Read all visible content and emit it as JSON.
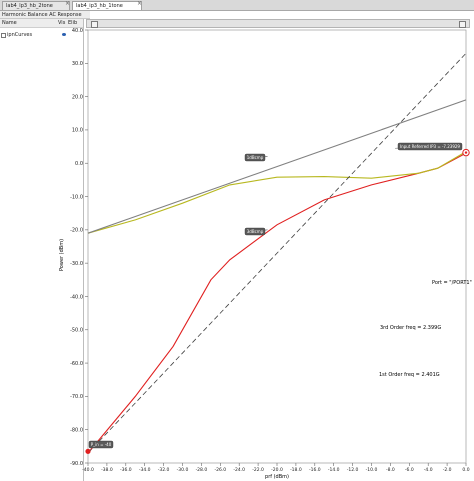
{
  "tabs": [
    {
      "label": "lab4_lp3_hb_2tone",
      "active": false
    },
    {
      "label": "lab4_ip3_hb_1tone",
      "active": true
    }
  ],
  "panel_title": "Harmonic Balance AC Response",
  "sidebar": {
    "col_name": "Name",
    "col_vis": "Vis",
    "col_vis2": "Elib",
    "item_label": "ipnCurves"
  },
  "colors": {
    "red": "#e02020",
    "olive": "#b8b820",
    "gray_line": "#808080",
    "dashed": "#404040",
    "marker_box": "#5a5a5a"
  },
  "chart_data": {
    "type": "line",
    "xlabel": "prf (dBm)",
    "ylabel": "Power (dBm)",
    "xlim": [
      -40.0,
      0.0
    ],
    "ylim": [
      -90.0,
      40.0
    ],
    "xticks": [
      "-40.0",
      "-38.0",
      "-36.0",
      "-34.0",
      "-32.0",
      "-30.0",
      "-28.0",
      "-26.0",
      "-24.0",
      "-22.0",
      "-20.0",
      "-18.0",
      "-16.0",
      "-14.0",
      "-12.0",
      "-10.0",
      "-8.0",
      "-6.0",
      "-4.0",
      "-2.0",
      "0.0"
    ],
    "yticks": [
      "40.0",
      "30.0",
      "20.0",
      "10.0",
      "0.0",
      "-10.0",
      "-20.0",
      "-30.0",
      "-40.0",
      "-50.0",
      "-60.0",
      "-70.0",
      "-80.0",
      "-90.0"
    ],
    "series": [
      {
        "style": "solid",
        "color": "#e02020",
        "x": [
          -40,
          -35,
          -31,
          -27,
          -25,
          -20,
          -15,
          -10,
          -5,
          -3,
          0
        ],
        "y": [
          -87,
          -70,
          -55,
          -35,
          -29,
          -18.5,
          -11,
          -6.5,
          -3,
          -1.5,
          3
        ]
      },
      {
        "style": "solid",
        "color": "#b8b820",
        "x": [
          -40,
          -35,
          -30,
          -25,
          -20,
          -15,
          -10,
          -5,
          -3,
          0
        ],
        "y": [
          -21,
          -17,
          -12,
          -6.5,
          -4.2,
          -4.0,
          -4.5,
          -3,
          -1.5,
          3.5
        ]
      },
      {
        "style": "solid",
        "color": "#808080",
        "x": [
          -40,
          0
        ],
        "y": [
          -21,
          19
        ]
      },
      {
        "style": "dashed",
        "color": "#404040",
        "x": [
          -40,
          0
        ],
        "y": [
          -87,
          33
        ]
      }
    ],
    "markers": [
      {
        "label": "1dBcmp",
        "x": -21,
        "y": 2
      },
      {
        "label": "3dBcmp",
        "x": -21,
        "y": -20
      },
      {
        "label": "Input Referred IP3 = -7.23929",
        "x": -7.5,
        "y": 4.5
      },
      {
        "label": "P_in = -40",
        "x": -38.5,
        "y": -84
      }
    ],
    "annotations": [
      "Port = \"/PORT1\"",
      "3rd Order freq = 2.399G",
      "1st Order freq = 2.401G"
    ],
    "grid": false
  }
}
